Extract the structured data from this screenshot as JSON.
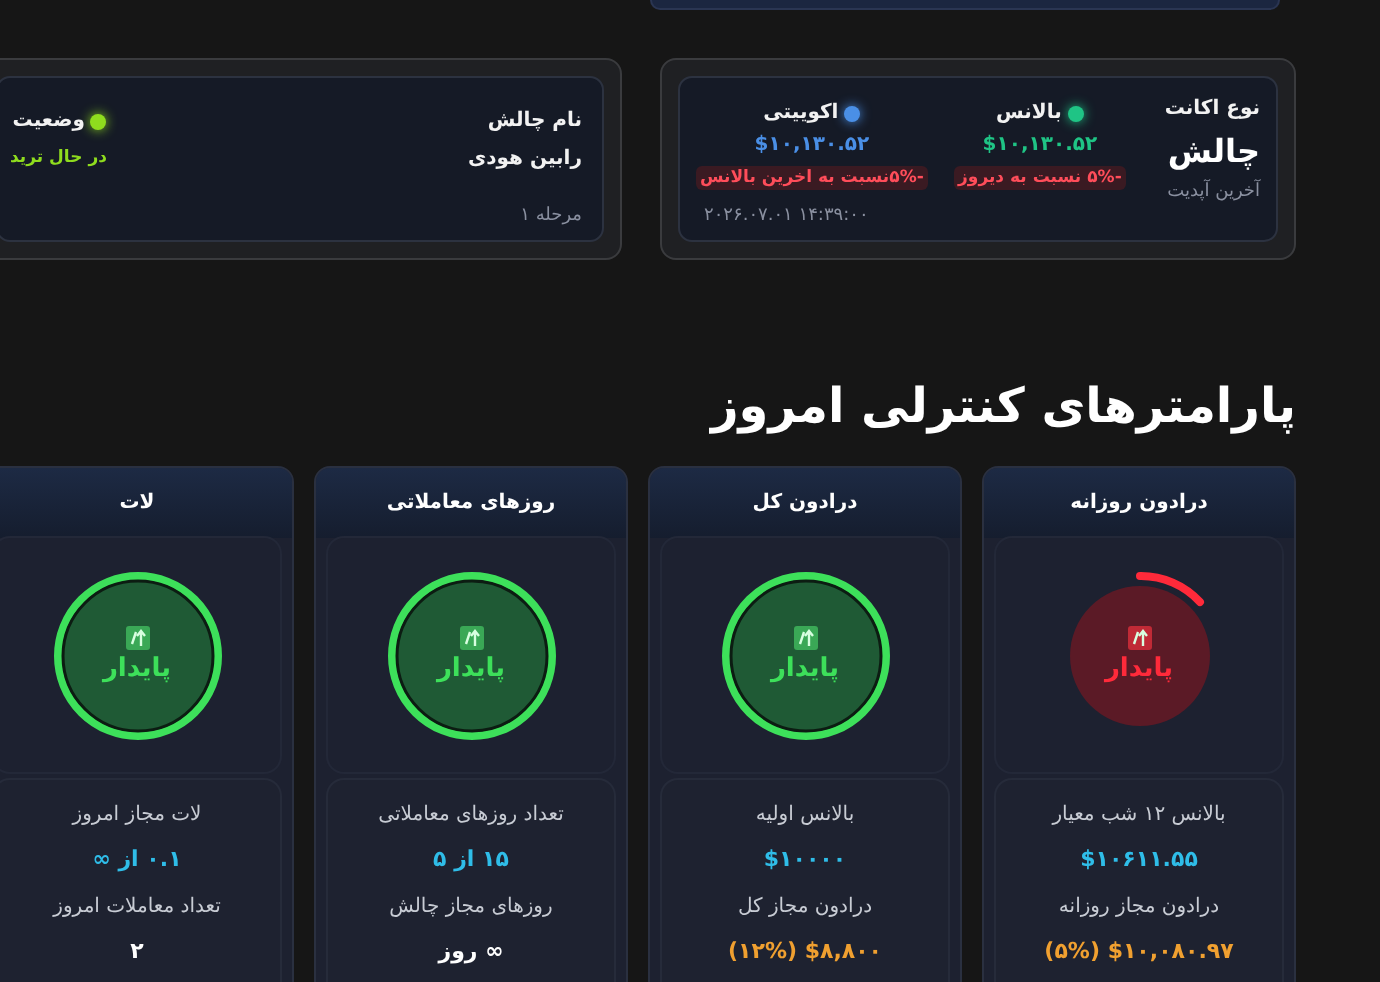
{
  "account_card": {
    "type_label": "نوع اکانت",
    "type_value": "چالش",
    "updated_label": "آخرین آپدیت",
    "updated_value": "۲۰۲۶.۰۷.۰۱ ۱۴:۳۹:۰۰",
    "metrics": [
      {
        "label": "بالانس",
        "color": "#1fc485",
        "value": "$۱۰,۱۳۰.۵۲",
        "change": "-۵% نسبت به دیروز"
      },
      {
        "label": "اکوییتی",
        "color": "#4a8fe6",
        "value": "$۱۰,۱۳۰.۵۲",
        "change": "-۵%نسبت به اخرین بالانس"
      }
    ]
  },
  "challenge_card": {
    "fields": [
      {
        "kind": "text",
        "label": "نام چالش",
        "value": "رابین هودی"
      },
      {
        "kind": "status",
        "label": "وضعیت",
        "color": "#8fdc1e",
        "value": "در حال ترید"
      }
    ],
    "stage": "مرحله ۱"
  },
  "section_title": "پارامترهای کنترلی امروز",
  "parameters": [
    {
      "title": "درادون روزانه",
      "kind": "danger",
      "status": "پایدار",
      "rows": [
        {
          "label": "بالانس ۱۲ شب معیار",
          "value": "$۱۰۶۱۱.۵۵",
          "kind": "amount"
        },
        {
          "label": "درادون مجاز روزانه",
          "value": "$۱۰,۰۸۰.۹۷ (۵%)",
          "kind": "limit"
        }
      ]
    },
    {
      "title": "درادون کل",
      "kind": "safe",
      "status": "پایدار",
      "rows": [
        {
          "label": "بالانس اولیه",
          "value": "$۱۰۰۰۰",
          "kind": "amount"
        },
        {
          "label": "درادون مجاز کل",
          "value": "$۸,۸۰۰ (۱۲%)",
          "kind": "limit"
        }
      ]
    },
    {
      "title": "روزهای معاملاتی",
      "kind": "safe",
      "status": "پایدار",
      "rows": [
        {
          "label": "تعداد روزهای معاملاتی",
          "value": "۱۵ از ۵",
          "kind": "amount"
        },
        {
          "label": "روزهای مجاز چالش",
          "value": "∞ روز",
          "kind": "plain"
        }
      ]
    },
    {
      "title": "لات",
      "kind": "safe",
      "status": "پایدار",
      "rows": [
        {
          "label": "لات مجاز امروز",
          "value": "۰.۱ از ∞",
          "kind": "amount"
        },
        {
          "label": "تعداد معاملات امروز",
          "value": "۲",
          "kind": "plain"
        }
      ]
    }
  ]
}
